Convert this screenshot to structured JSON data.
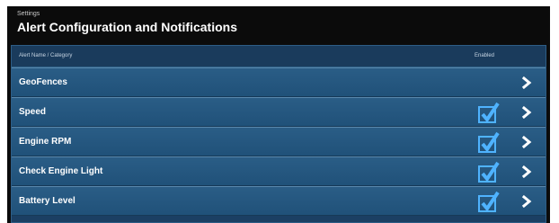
{
  "breadcrumb": "Settings",
  "page_title": "Alert Configuration and Notifications",
  "table": {
    "headers": {
      "name": "Alert Name / Category",
      "enabled": "Enabled"
    },
    "rows": [
      {
        "label": "GeoFences",
        "enabled": false
      },
      {
        "label": "Speed",
        "enabled": true
      },
      {
        "label": "Engine RPM",
        "enabled": true
      },
      {
        "label": "Check Engine Light",
        "enabled": true
      },
      {
        "label": "Battery Level",
        "enabled": true
      }
    ]
  },
  "icons": {
    "enabled": "checkmark-icon",
    "open": "chevron-right-icon"
  },
  "colors": {
    "page_bg": "#0b0b0b",
    "row_bg": "#2a5d86",
    "check": "#4fb3ff",
    "text": "#ffffff"
  }
}
